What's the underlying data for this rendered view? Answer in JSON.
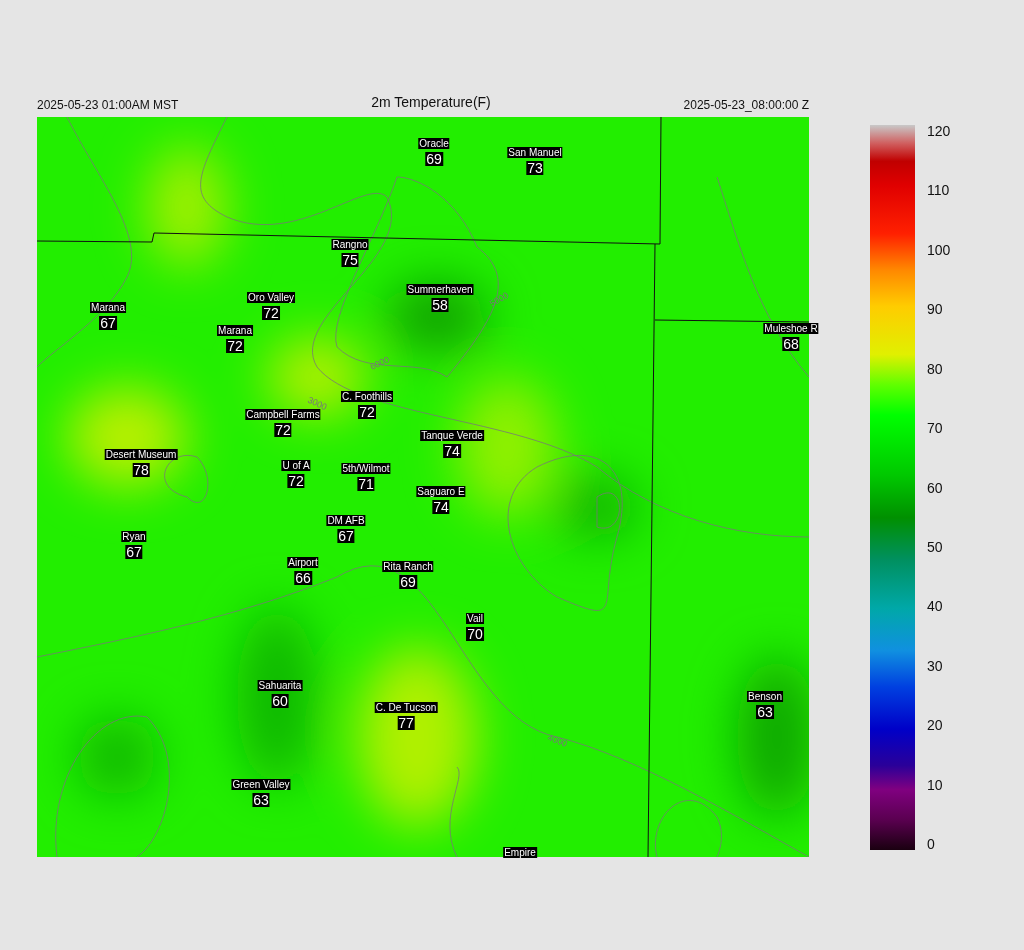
{
  "header": {
    "local_time": "2025-05-23 01:00AM MST",
    "title": "2m Temperature(F)",
    "utc_time": "2025-05-23_08:00:00 Z"
  },
  "stations": [
    {
      "name": "Oracle",
      "value": "69"
    },
    {
      "name": "San Manuel",
      "value": "73"
    },
    {
      "name": "Rangno",
      "value": "75"
    },
    {
      "name": "Summerhaven",
      "value": "58"
    },
    {
      "name": "Marana",
      "value": "67"
    },
    {
      "name": "Oro Valley",
      "value": "72"
    },
    {
      "name": "Marana",
      "value": "72"
    },
    {
      "name": "Muleshoe R",
      "value": "68"
    },
    {
      "name": "C. Foothills",
      "value": "72"
    },
    {
      "name": "Campbell Farms",
      "value": "72"
    },
    {
      "name": "Tanque Verde",
      "value": "74"
    },
    {
      "name": "Desert Museum",
      "value": "78"
    },
    {
      "name": "U of A",
      "value": "72"
    },
    {
      "name": "5th/Wilmot",
      "value": "71"
    },
    {
      "name": "Saguaro E",
      "value": "74"
    },
    {
      "name": "Ryan",
      "value": "67"
    },
    {
      "name": "DM AFB",
      "value": "67"
    },
    {
      "name": "Airport",
      "value": "66"
    },
    {
      "name": "Rita Ranch",
      "value": "69"
    },
    {
      "name": "Vail",
      "value": "70"
    },
    {
      "name": "Sahuarita",
      "value": "60"
    },
    {
      "name": "C. De Tucson",
      "value": "77"
    },
    {
      "name": "Benson",
      "value": "63"
    },
    {
      "name": "Green Valley",
      "value": "63"
    },
    {
      "name": "Empire"
    }
  ],
  "contour_labels": [
    "3000",
    "4000",
    "5000",
    "6000"
  ],
  "colorbar": {
    "ticks": [
      "120",
      "110",
      "100",
      "90",
      "80",
      "70",
      "60",
      "50",
      "40",
      "30",
      "20",
      "10",
      "0"
    ]
  }
}
